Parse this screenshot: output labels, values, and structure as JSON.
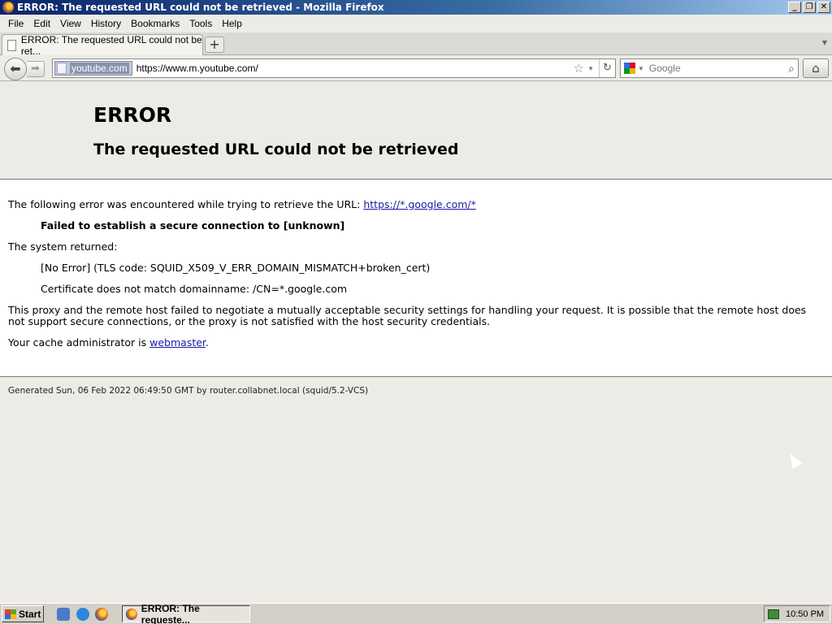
{
  "window": {
    "title": "ERROR: The requested URL could not be retrieved - Mozilla Firefox"
  },
  "menu": [
    "File",
    "Edit",
    "View",
    "History",
    "Bookmarks",
    "Tools",
    "Help"
  ],
  "tab": {
    "title": "ERROR: The requested URL could not be ret...",
    "new_tab": "+"
  },
  "navbar": {
    "identity": "youtube.com",
    "url": "https://www.m.youtube.com/",
    "search_placeholder": "Google"
  },
  "page": {
    "heading": "ERROR",
    "subheading": "The requested URL could not be retrieved",
    "intro": "The following error was encountered while trying to retrieve the URL:",
    "error_url": "https://*.google.com/*",
    "failure": "Failed to establish a secure connection to [unknown]",
    "system_returned": "The system returned:",
    "tls_code": "[No Error] (TLS code: SQUID_X509_V_ERR_DOMAIN_MISMATCH+broken_cert)",
    "cert_mismatch": "Certificate does not match domainname: /CN=*.google.com",
    "explanation": "This proxy and the remote host failed to negotiate a mutually acceptable security settings for handling your request. It is possible that the remote host does not support secure connections, or the proxy is not satisfied with the host security credentials.",
    "admin_prefix": "Your cache administrator is",
    "admin_link": "webmaster",
    "admin_suffix": ".",
    "footer": "Generated Sun, 06 Feb 2022 06:49:50 GMT by router.collabnet.local (squid/5.2-VCS)"
  },
  "taskbar": {
    "start": "Start",
    "task": "ERROR: The requeste...",
    "clock": "10:50 PM"
  },
  "colors": {
    "link": "#1a1aa6",
    "title_bar": "#0a246a",
    "taskbar": "#d4d0c8"
  }
}
